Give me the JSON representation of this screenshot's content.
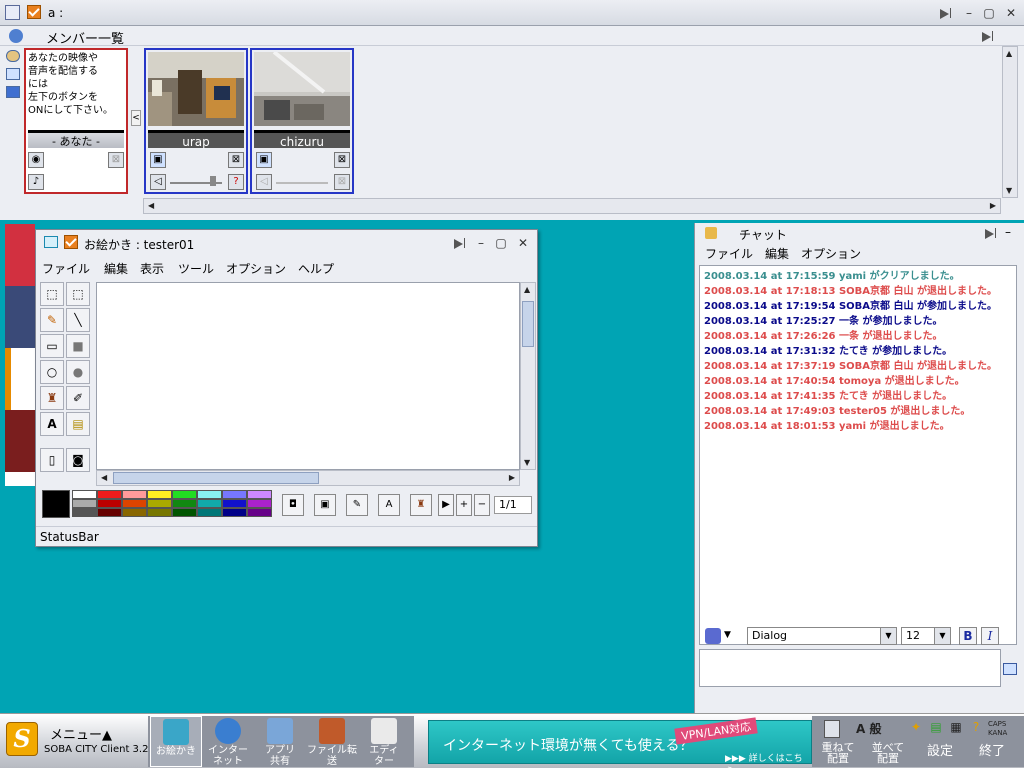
{
  "window": {
    "title": "a :"
  },
  "member_panel": {
    "title": "メンバー一覧",
    "you_notice": [
      "あなたの映像や",
      "音声を配信する",
      "には",
      "左下のボタンを",
      "ONにして下さい。"
    ],
    "you_label": "- あなた -",
    "members": [
      {
        "name": "urap"
      },
      {
        "name": "chizuru"
      }
    ]
  },
  "paint": {
    "title": "お絵かき : tester01",
    "menu": [
      "ファイル",
      "編集",
      "表示",
      "ツール",
      "オプション",
      "ヘルプ"
    ],
    "page": "1/1",
    "status": "StatusBar",
    "palette": [
      "#ffffff",
      "#ee1c1c",
      "#ff9a9a",
      "#ffee22",
      "#22dd22",
      "#88f2f2",
      "#7777ff",
      "#cc88ff",
      "#aaaaaa",
      "#bb0000",
      "#dd4400",
      "#aaaa00",
      "#118811",
      "#11aaaa",
      "#1111cc",
      "#aa22cc",
      "#555555",
      "#660000",
      "#886600",
      "#777700",
      "#005500",
      "#007777",
      "#000088",
      "#660088"
    ]
  },
  "chat": {
    "title": "チャット",
    "menu": [
      "ファイル",
      "編集",
      "オプション"
    ],
    "messages": [
      {
        "text": "2008.03.14 at 17:15:59 yami がクリアしました。",
        "color": "#3a8f8f"
      },
      {
        "text": "2008.03.14 at 17:18:13 SOBA京都 白山 が退出しました。",
        "color": "#dd4c4c"
      },
      {
        "text": "2008.03.14 at 17:19:54 SOBA京都 白山 が参加しました。",
        "color": "#0a0a8a"
      },
      {
        "text": "2008.03.14 at 17:25:27 一条 が参加しました。",
        "color": "#0a0a8a"
      },
      {
        "text": "2008.03.14 at 17:26:26 一条 が退出しました。",
        "color": "#dd4c4c"
      },
      {
        "text": "2008.03.14 at 17:31:32 たてき が参加しました。",
        "color": "#0a0a8a"
      },
      {
        "text": "2008.03.14 at 17:37:19 SOBA京都 白山 が退出しました。",
        "color": "#dd4c4c"
      },
      {
        "text": "2008.03.14 at 17:40:54 tomoya が退出しました。",
        "color": "#dd4c4c"
      },
      {
        "text": "2008.03.14 at 17:41:35 たてき が退出しました。",
        "color": "#dd4c4c"
      },
      {
        "text": "2008.03.14 at 17:49:03 tester05 が退出しました。",
        "color": "#dd4c4c"
      },
      {
        "text": "2008.03.14 at 18:01:53 yami が退出しました。",
        "color": "#dd4c4c"
      }
    ],
    "font_name": "Dialog",
    "font_size": "12",
    "bold_label": "B",
    "italic_label": "I"
  },
  "taskbar": {
    "logo": "S",
    "menu_label": "メニュー▲",
    "client_label": "SOBA CITY Client 3.2.7",
    "apps": [
      {
        "label1": "お絵かき",
        "label2": "",
        "color": "#3aa6c8"
      },
      {
        "label1": "インター",
        "label2": "ネット",
        "color": "#3a7ed0"
      },
      {
        "label1": "アプリ",
        "label2": "共有",
        "color": "#7aa6d8"
      },
      {
        "label1": "ファイル転送",
        "label2": "",
        "color": "#c05a2a"
      },
      {
        "label1": "エディ",
        "label2": "ター",
        "color": "#eaeaea"
      }
    ],
    "banner_text": "インターネット環境が無くても使える？",
    "banner_badge": "VPN/LAN対応",
    "banner_more": "▶▶▶ 詳しくはこちら",
    "right_buttons": [
      {
        "label1": "重ねて",
        "label2": "配置"
      },
      {
        "label1": "並べて",
        "label2": "配置"
      },
      {
        "label1": "設定",
        "label2": ""
      },
      {
        "label1": "終了",
        "label2": ""
      }
    ],
    "tray_labels": {
      "ime": "A 般",
      "caps": "CAPS",
      "kana": "KANA"
    }
  }
}
